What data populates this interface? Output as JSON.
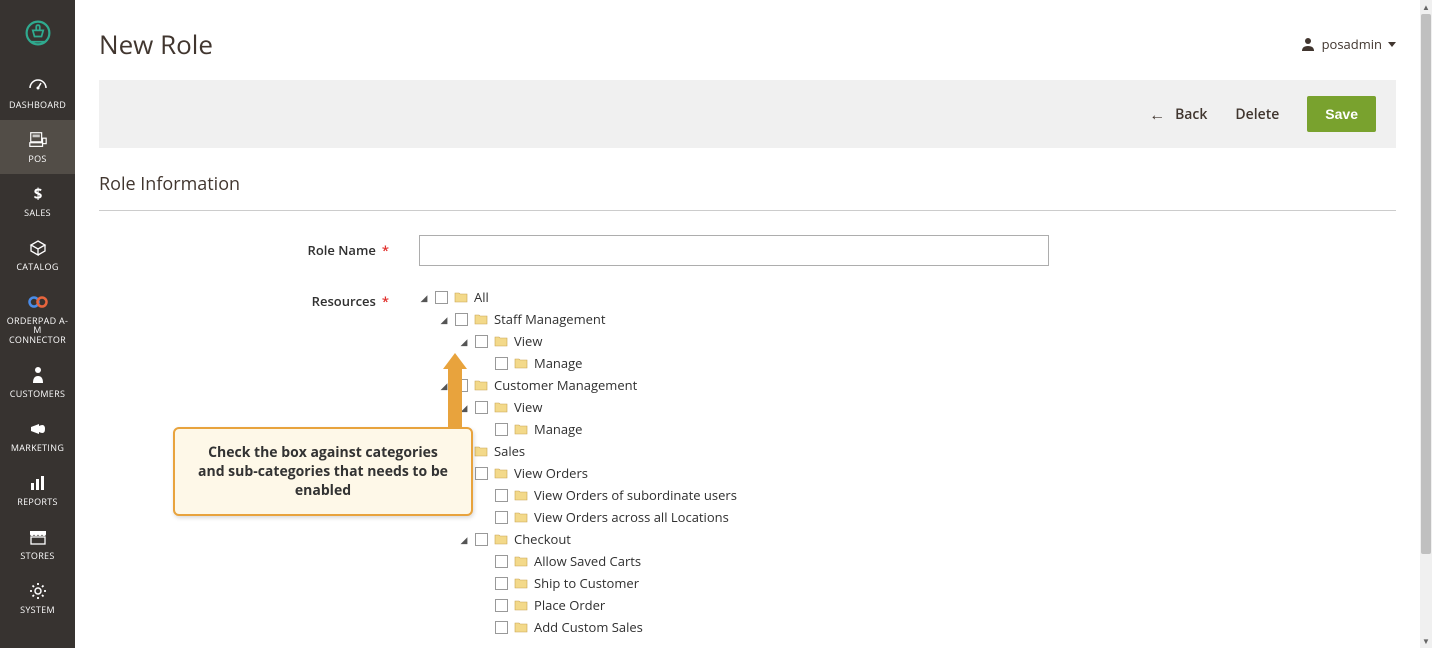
{
  "sidebar": {
    "items": [
      {
        "label": "DASHBOARD",
        "icon": "gauge"
      },
      {
        "label": "POS",
        "icon": "register",
        "active": true
      },
      {
        "label": "SALES",
        "icon": "dollar"
      },
      {
        "label": "CATALOG",
        "icon": "cube"
      },
      {
        "label": "ORDERPAD A-M CONNECTOR",
        "icon": "link"
      },
      {
        "label": "CUSTOMERS",
        "icon": "person"
      },
      {
        "label": "MARKETING",
        "icon": "horn"
      },
      {
        "label": "REPORTS",
        "icon": "bars"
      },
      {
        "label": "STORES",
        "icon": "storefront"
      },
      {
        "label": "SYSTEM",
        "icon": "gear"
      }
    ]
  },
  "header": {
    "title": "New Role",
    "user": "posadmin"
  },
  "actions": {
    "back": "Back",
    "delete": "Delete",
    "save": "Save"
  },
  "section": {
    "title": "Role Information",
    "roleNameLabel": "Role Name",
    "roleNameValue": "",
    "resourcesLabel": "Resources"
  },
  "tree": {
    "root": "All",
    "nodes": [
      {
        "label": "Staff Management",
        "level": 1,
        "expanded": true,
        "children": [
          {
            "label": "View",
            "level": 2,
            "expanded": true,
            "children": [
              {
                "label": "Manage",
                "level": 3
              }
            ]
          }
        ]
      },
      {
        "label": "Customer Management",
        "level": 1,
        "expanded": true,
        "children": [
          {
            "label": "View",
            "level": 2,
            "expanded": true,
            "children": [
              {
                "label": "Manage",
                "level": 3
              }
            ]
          }
        ]
      },
      {
        "label": "Sales",
        "level": 1,
        "expanded": true,
        "children": [
          {
            "label": "View Orders",
            "level": 2,
            "expanded": true,
            "children": [
              {
                "label": "View Orders of subordinate users",
                "level": 3
              },
              {
                "label": "View Orders across all Locations",
                "level": 3
              }
            ]
          },
          {
            "label": "Checkout",
            "level": 2,
            "expanded": true,
            "children": [
              {
                "label": "Allow Saved Carts",
                "level": 3
              },
              {
                "label": "Ship to Customer",
                "level": 3
              },
              {
                "label": "Place Order",
                "level": 3
              },
              {
                "label": "Add Custom Sales",
                "level": 3
              }
            ]
          }
        ]
      }
    ]
  },
  "callout": {
    "text": "Check the box against categories and sub-categories that needs to be enabled"
  }
}
